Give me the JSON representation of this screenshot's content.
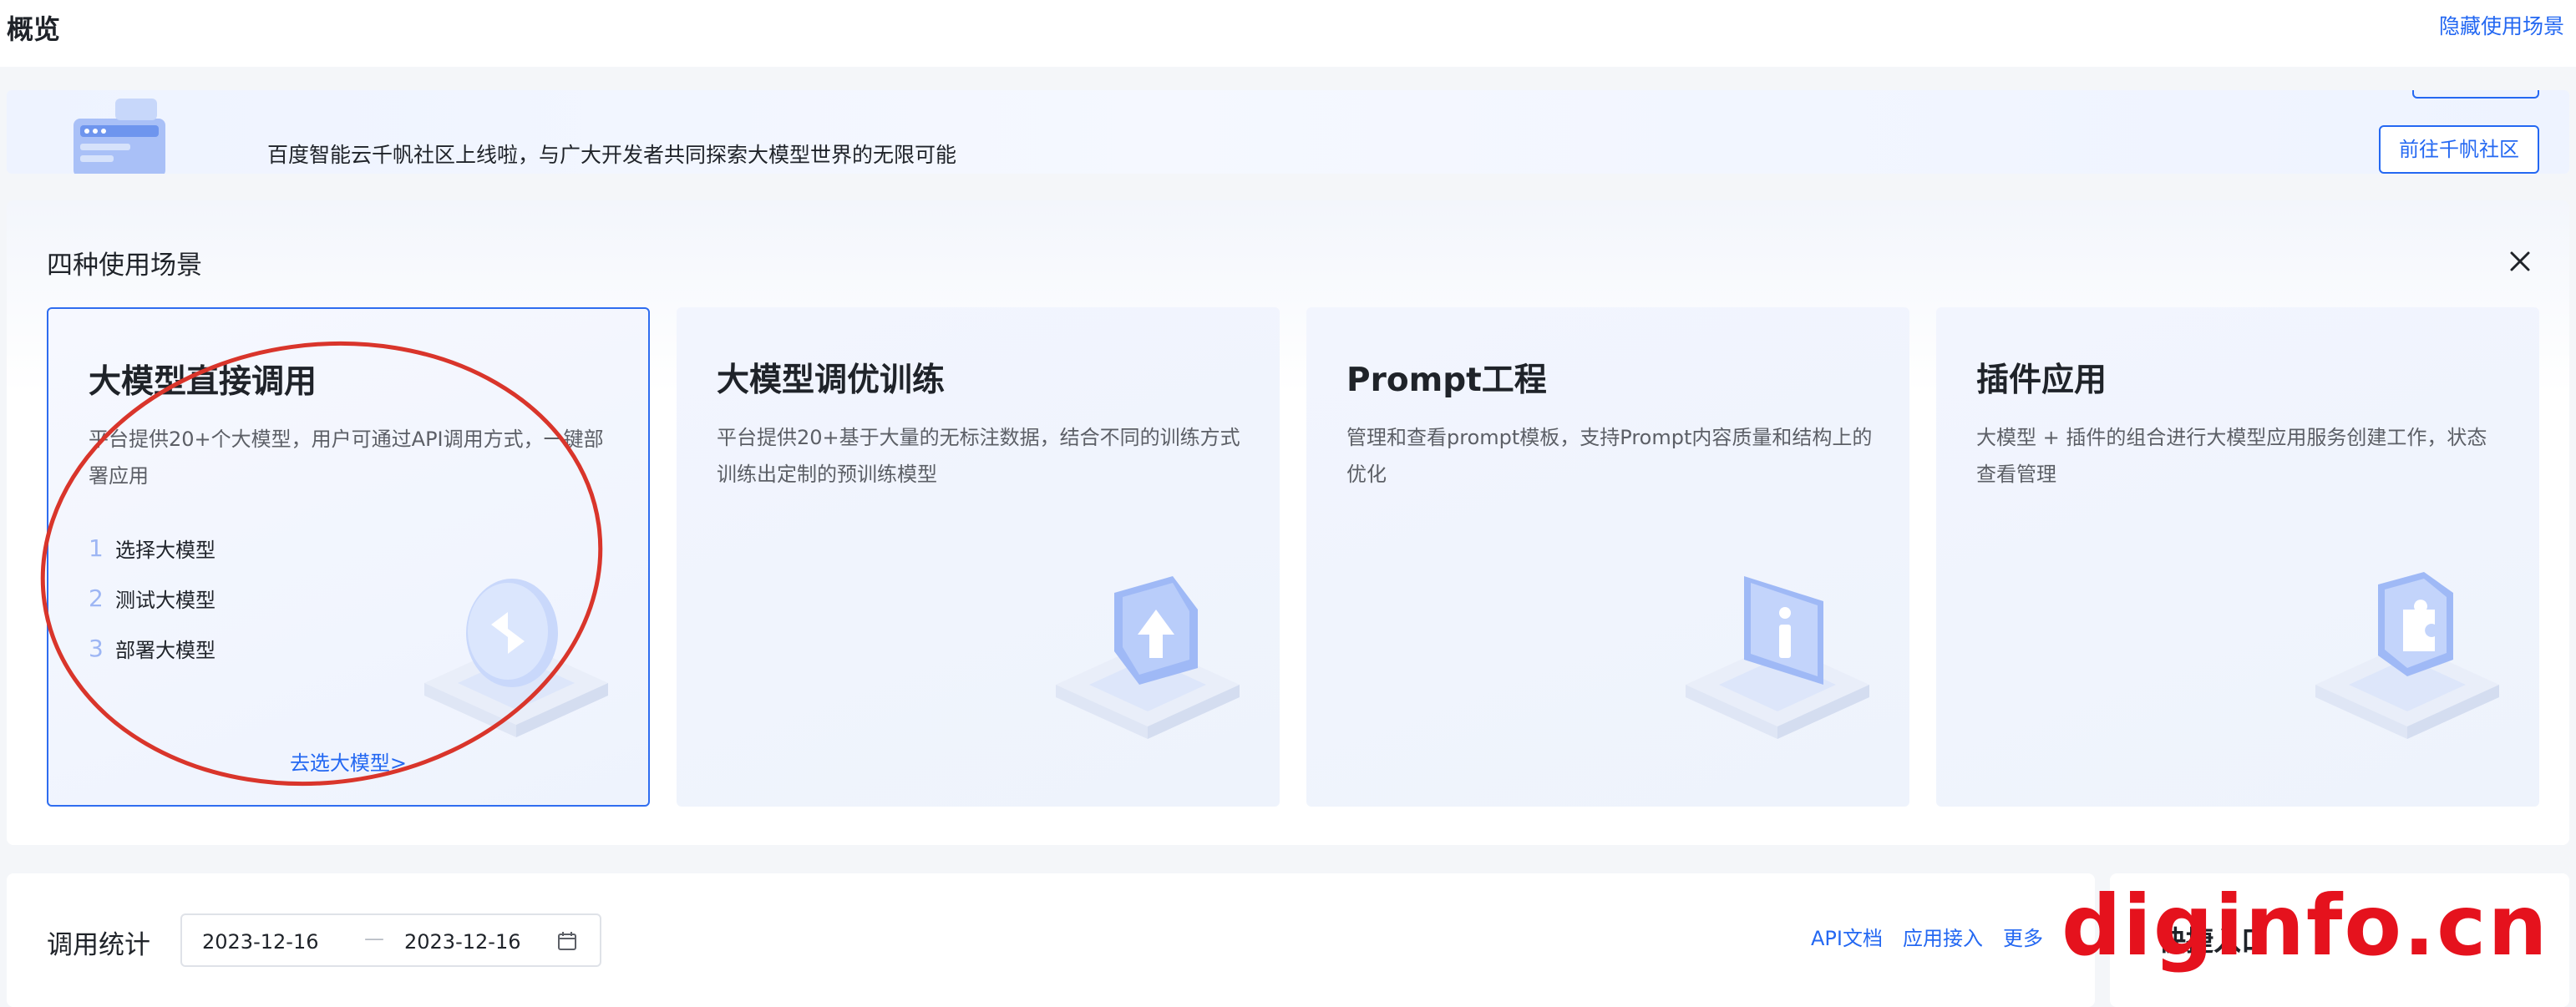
{
  "header": {
    "title": "概览",
    "hide_link": "隐藏使用场景"
  },
  "banner": {
    "text": "百度智能云千帆社区上线啦，与广大开发者共同探索大模型世界的无限可能",
    "button": "前往千帆社区"
  },
  "scenarios": {
    "title": "四种使用场景",
    "cards": [
      {
        "title": "大模型直接调用",
        "desc": "平台提供20+个大模型，用户可通过API调用方式，一键部署应用",
        "steps": [
          {
            "num": "1",
            "label": "选择大模型"
          },
          {
            "num": "2",
            "label": "测试大模型"
          },
          {
            "num": "3",
            "label": "部署大模型"
          }
        ],
        "link": "去选大模型>"
      },
      {
        "title": "大模型调优训练",
        "desc": "平台提供20+基于大量的无标注数据，结合不同的训练方式训练出定制的预训练模型"
      },
      {
        "title": "Prompt工程",
        "desc": "管理和查看prompt模板，支持Prompt内容质量和结构上的优化"
      },
      {
        "title": "插件应用",
        "desc": "大模型 + 插件的组合进行大模型应用服务创建工作，状态查看管理"
      }
    ]
  },
  "stats": {
    "title": "调用统计",
    "date_start": "2023-12-16",
    "date_sep": "—",
    "date_end": "2023-12-16",
    "links": [
      "API文档",
      "应用接入",
      "更多"
    ]
  },
  "quick": {
    "title": "快捷入口"
  },
  "watermark": "diginfo.cn",
  "colors": {
    "accent": "#2468f2",
    "annotation": "#d9352b",
    "watermark": "#e5121d"
  }
}
